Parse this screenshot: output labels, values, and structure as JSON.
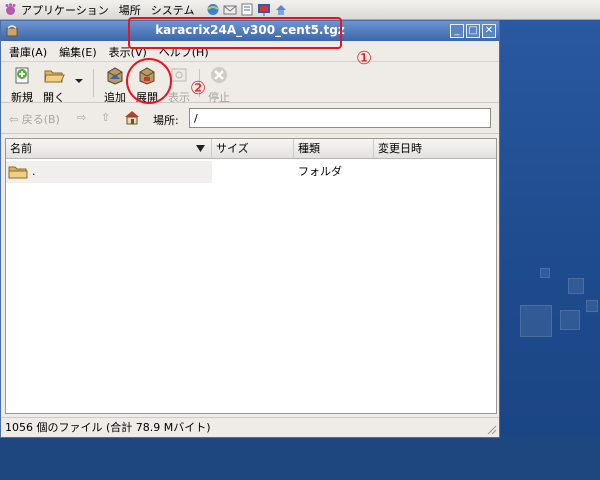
{
  "top_panel": {
    "menus": [
      "アプリケーション",
      "場所",
      "システム"
    ]
  },
  "window": {
    "title": "karacrix24A_v300_cent5.tgz",
    "controls": {
      "minimize": "_",
      "maximize": "□",
      "close": "✕"
    }
  },
  "menubar": [
    "書庫(A)",
    "編集(E)",
    "表示(V)",
    "ヘルプ(H)"
  ],
  "toolbar": {
    "new_label": "新規",
    "open_label": "開く",
    "add_label": "追加",
    "extract_label": "展開",
    "view_label": "表示",
    "stop_label": "停止"
  },
  "locbar": {
    "back_label": "戻る(B)",
    "location_label": "場所:",
    "location_value": "/"
  },
  "list": {
    "columns": [
      "名前",
      "サイズ",
      "種類",
      "変更日時"
    ],
    "rows": [
      {
        "name": ".",
        "size": "",
        "type": "フォルダ",
        "modified": ""
      }
    ]
  },
  "status": "1056 個のファイル (合計 78.9 Mバイト)",
  "annotations": {
    "one": "①",
    "two": "②",
    "color": "#e8141e"
  },
  "colors": {
    "desktop": "#1f4c8f",
    "titlebar": "#3c66ac"
  }
}
